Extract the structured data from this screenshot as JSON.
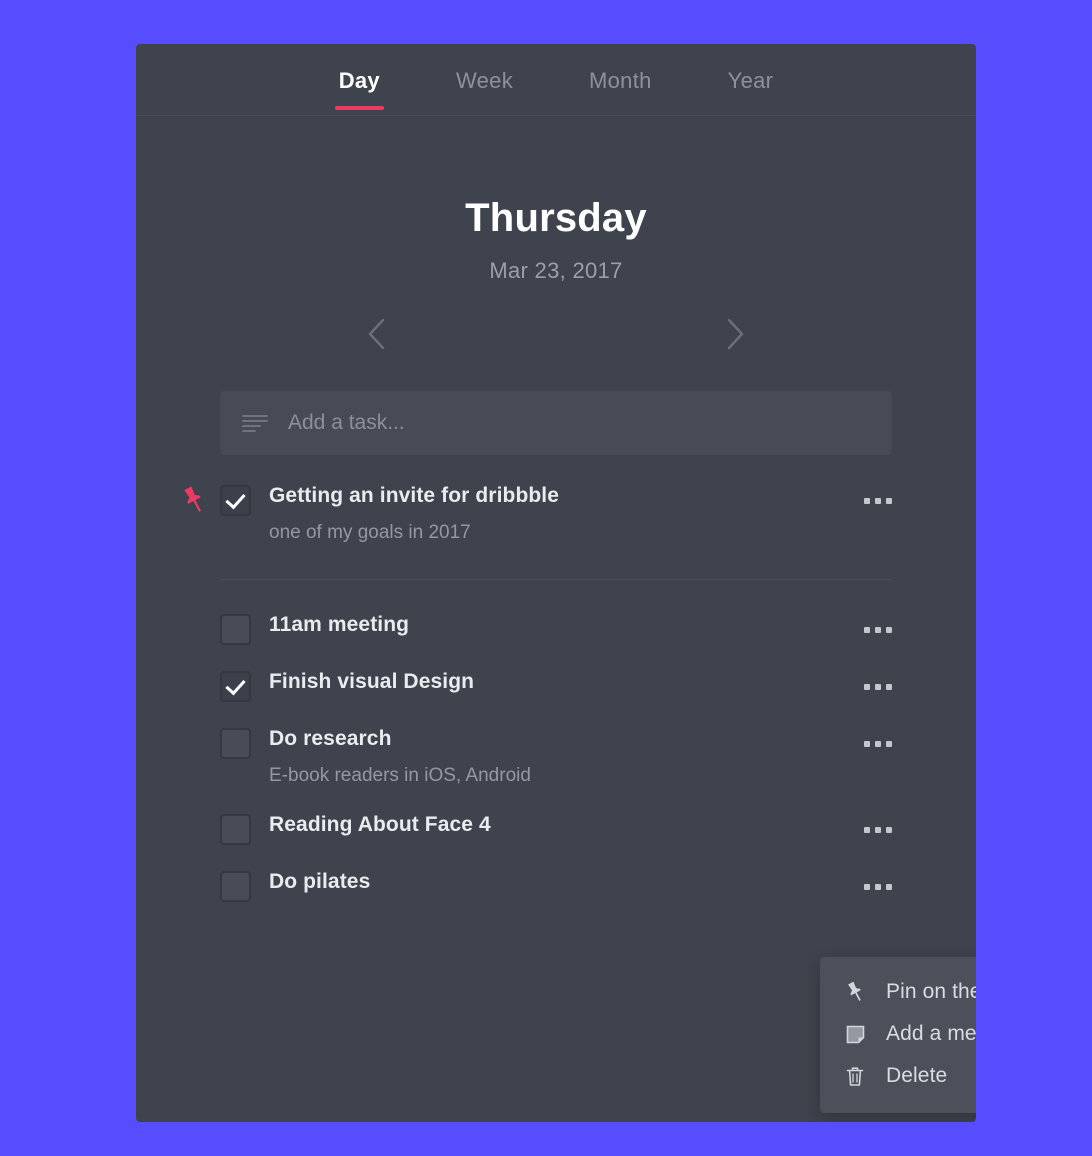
{
  "app": {
    "accent_color": "#ed3a63",
    "background_color": "#574dff",
    "card_color": "#3e434d",
    "menu_color": "#4b505b"
  },
  "tabs": [
    {
      "label": "Day",
      "active": true
    },
    {
      "label": "Week",
      "active": false
    },
    {
      "label": "Month",
      "active": false
    },
    {
      "label": "Year",
      "active": false
    }
  ],
  "date_header": {
    "day_name": "Thursday",
    "date": "Mar 23, 2017",
    "prev_icon": "chevron-left-icon",
    "next_icon": "chevron-right-icon"
  },
  "add_task": {
    "placeholder": "Add a task...",
    "value": "",
    "icon": "list-lines-icon"
  },
  "pinned_tasks": [
    {
      "title": "Getting an invite for dribbble",
      "memo": "one of my goals in 2017",
      "checked": true,
      "pinned": true,
      "pin_icon": "pin-icon",
      "menu_icon": "more-dots-icon"
    }
  ],
  "tasks": [
    {
      "title": "11am meeting",
      "memo": "",
      "checked": false,
      "menu_icon": "more-dots-icon"
    },
    {
      "title": "Finish visual Design",
      "memo": "",
      "checked": true,
      "menu_icon": "more-dots-icon"
    },
    {
      "title": "Do research",
      "memo": "E-book readers in iOS, Android",
      "checked": false,
      "menu_icon": "more-dots-icon"
    },
    {
      "title": "Reading About Face 4",
      "memo": "",
      "checked": false,
      "menu_icon": "more-dots-icon"
    },
    {
      "title": "Do pilates",
      "memo": "",
      "checked": false,
      "menu_icon": "more-dots-icon"
    }
  ],
  "context_menu": {
    "visible": true,
    "items": [
      {
        "label": "Pin on the top",
        "icon": "pin-icon"
      },
      {
        "label": "Add a memo",
        "icon": "memo-note-icon"
      },
      {
        "label": "Delete",
        "icon": "trash-icon"
      }
    ]
  }
}
